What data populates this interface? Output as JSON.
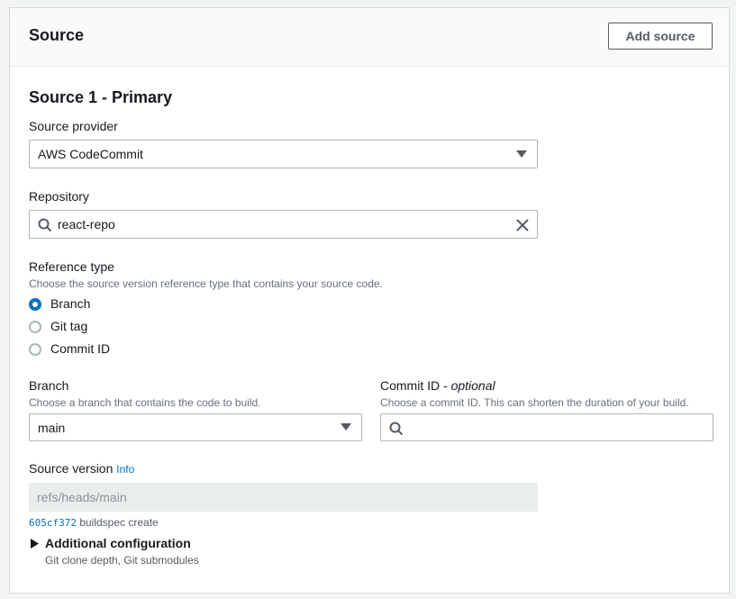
{
  "section": {
    "title": "Source",
    "add_button": "Add source"
  },
  "primary": {
    "title": "Source 1 - Primary",
    "provider": {
      "label": "Source provider",
      "value": "AWS CodeCommit"
    },
    "repository": {
      "label": "Repository",
      "value": "react-repo"
    },
    "reference": {
      "label": "Reference type",
      "description": "Choose the source version reference type that contains your source code.",
      "options": [
        {
          "label": "Branch",
          "checked": true
        },
        {
          "label": "Git tag",
          "checked": false
        },
        {
          "label": "Commit ID",
          "checked": false
        }
      ]
    },
    "branch": {
      "label": "Branch",
      "description": "Choose a branch that contains the code to build.",
      "value": "main"
    },
    "commit": {
      "label": "Commit ID",
      "optional": "optional",
      "description": "Choose a commit ID. This can shorten the duration of your build.",
      "value": ""
    },
    "source_version": {
      "label": "Source version",
      "info": "Info",
      "value": "refs/heads/main",
      "commit_hash": "605cf372",
      "commit_message": "buildspec create"
    },
    "additional": {
      "label": "Additional configuration",
      "description": "Git clone depth, Git submodules"
    }
  },
  "colors": {
    "accent": "#0073bb",
    "border": "#aab7b8",
    "muted": "#687078"
  }
}
